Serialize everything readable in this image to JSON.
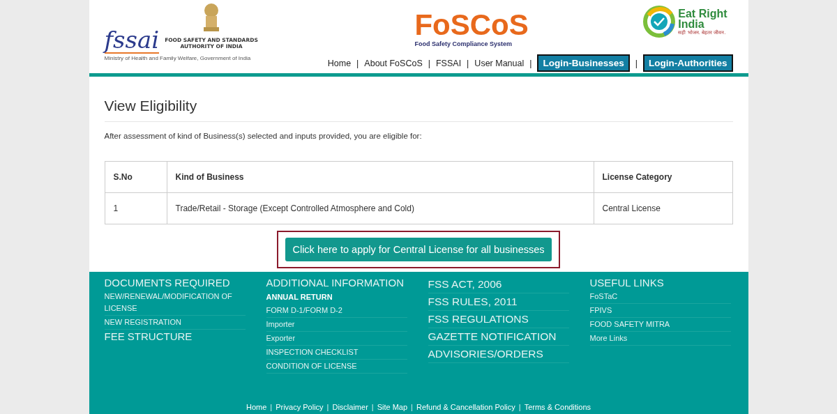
{
  "header": {
    "fssai_logo": "fssai",
    "authority_name": "FOOD SAFETY AND STANDARDS\nAUTHORITY OF INDIA",
    "ministry": "Ministry of Health and Family Welfare, Government of India",
    "brand": "FoSCoS",
    "brand_tagline": "Food Safety Compliance System",
    "eat_right": "Eat Right\nIndia",
    "eat_right_tagline": "सही भोजन. बेहतर जीवन.",
    "nav": [
      {
        "kind": "link",
        "label": "Home"
      },
      {
        "kind": "separator",
        "label": "|"
      },
      {
        "kind": "link",
        "label": "About FoSCoS"
      },
      {
        "kind": "separator",
        "label": "|"
      },
      {
        "kind": "link",
        "label": "FSSAI"
      },
      {
        "kind": "separator",
        "label": "|"
      },
      {
        "kind": "link",
        "label": "User Manual"
      },
      {
        "kind": "separator",
        "label": "|"
      },
      {
        "kind": "button",
        "label": "Login-Businesses"
      },
      {
        "kind": "separator",
        "label": "|"
      },
      {
        "kind": "button",
        "label": "Login-Authorities"
      }
    ]
  },
  "page": {
    "title": "View Eligibility",
    "intro": "After assessment of kind of Business(s) selected and inputs provided, you are eligible for:"
  },
  "table": {
    "columns": [
      "S.No",
      "Kind of Business",
      "License Category"
    ],
    "rows": [
      [
        "1",
        "Trade/Retail - Storage (Except Controlled Atmosphere and Cold)",
        "Central License"
      ]
    ]
  },
  "apply_button": "Click here to apply for Central License for all businesses",
  "footer": {
    "columns": [
      {
        "items": [
          {
            "kind": "heading",
            "label": "DOCUMENTS REQUIRED"
          },
          {
            "kind": "link",
            "label": "NEW/RENEWAL/MODIFICATION OF LICENSE"
          },
          {
            "kind": "link",
            "label": "NEW REGISTRATION"
          },
          {
            "kind": "heading",
            "label": "FEE STRUCTURE"
          }
        ]
      },
      {
        "items": [
          {
            "kind": "heading",
            "label": "ADDITIONAL INFORMATION"
          },
          {
            "kind": "bold",
            "label": "ANNUAL RETURN"
          },
          {
            "kind": "link",
            "label": "FORM D-1/FORM D-2"
          },
          {
            "kind": "link",
            "label": "Importer"
          },
          {
            "kind": "link",
            "label": "Exporter"
          },
          {
            "kind": "link",
            "label": "INSPECTION CHECKLIST"
          },
          {
            "kind": "link",
            "label": "CONDITION OF LICENSE"
          }
        ]
      },
      {
        "items": [
          {
            "kind": "big",
            "label": "FSS ACT, 2006"
          },
          {
            "kind": "big",
            "label": "FSS RULES, 2011"
          },
          {
            "kind": "big",
            "label": "FSS REGULATIONS"
          },
          {
            "kind": "big",
            "label": "GAZETTE NOTIFICATION"
          },
          {
            "kind": "big",
            "label": "ADVISORIES/ORDERS"
          }
        ]
      },
      {
        "items": [
          {
            "kind": "heading",
            "label": "USEFUL LINKS"
          },
          {
            "kind": "link",
            "label": "FoSTaC"
          },
          {
            "kind": "link",
            "label": "FPIVS"
          },
          {
            "kind": "link",
            "label": "FOOD SAFETY MITRA"
          },
          {
            "kind": "link",
            "label": "More Links"
          }
        ]
      }
    ],
    "bottom_links": [
      {
        "kind": "link",
        "label": "Home"
      },
      {
        "kind": "separator",
        "label": "|"
      },
      {
        "kind": "link",
        "label": "Privacy Policy"
      },
      {
        "kind": "separator",
        "label": "|"
      },
      {
        "kind": "link",
        "label": "Disclaimer"
      },
      {
        "kind": "separator",
        "label": "|"
      },
      {
        "kind": "link",
        "label": "Site Map"
      },
      {
        "kind": "separator",
        "label": "|"
      },
      {
        "kind": "link",
        "label": "Refund & Cancellation Policy"
      },
      {
        "kind": "separator",
        "label": "|"
      },
      {
        "kind": "link",
        "label": "Terms & Conditions"
      }
    ]
  }
}
